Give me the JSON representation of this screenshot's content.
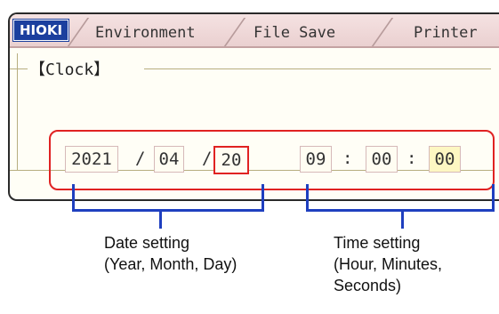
{
  "header": {
    "logo": "HIOKI",
    "tabs": [
      "Environment",
      "File Save",
      "Printer"
    ]
  },
  "clock_group": {
    "label": "【Clock】",
    "year": "2021",
    "month": "04",
    "day": "20",
    "hour": "09",
    "minute": "00",
    "second": "00",
    "date_sep": "/",
    "time_sep": ":"
  },
  "captions": {
    "date_line1": "Date setting",
    "date_line2": "(Year, Month, Day)",
    "time_line1": "Time setting",
    "time_line2": "(Hour, Minutes,",
    "time_line3": "Seconds)"
  },
  "colors": {
    "highlight": "#e02222",
    "bracket": "#1f3fbf",
    "logo_bg": "#1b3f9e"
  }
}
